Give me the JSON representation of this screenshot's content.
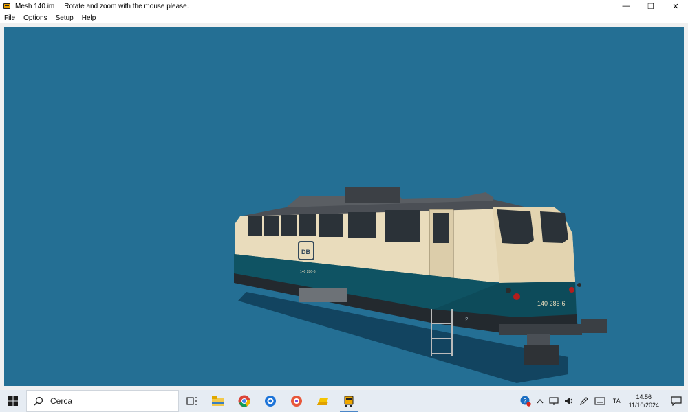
{
  "window": {
    "title": "Mesh 140.im",
    "hint": "Rotate and zoom with the mouse please.",
    "controls": {
      "minimize": "—",
      "restore": "❐",
      "close": "✕"
    }
  },
  "menu": {
    "items": [
      {
        "label": "File"
      },
      {
        "label": "Options"
      },
      {
        "label": "Setup"
      },
      {
        "label": "Help"
      }
    ]
  },
  "viewport": {
    "background": "#246f94",
    "model": {
      "front_number": "140 286-6",
      "side_number": "140 286-6",
      "logo": "DB",
      "end_label": "2"
    }
  },
  "taskbar": {
    "search_placeholder": "Cerca",
    "apps": [
      {
        "icon": "task-view-icon"
      },
      {
        "icon": "file-explorer-icon"
      },
      {
        "icon": "chrome-icon"
      },
      {
        "icon": "browser-icon"
      },
      {
        "icon": "media-app-icon"
      },
      {
        "icon": "folder-app-icon"
      },
      {
        "icon": "mesh-viewer-icon",
        "active": true
      }
    ],
    "tray": {
      "language": "ITA",
      "time": "14:56",
      "date": "11/10/2024"
    }
  }
}
